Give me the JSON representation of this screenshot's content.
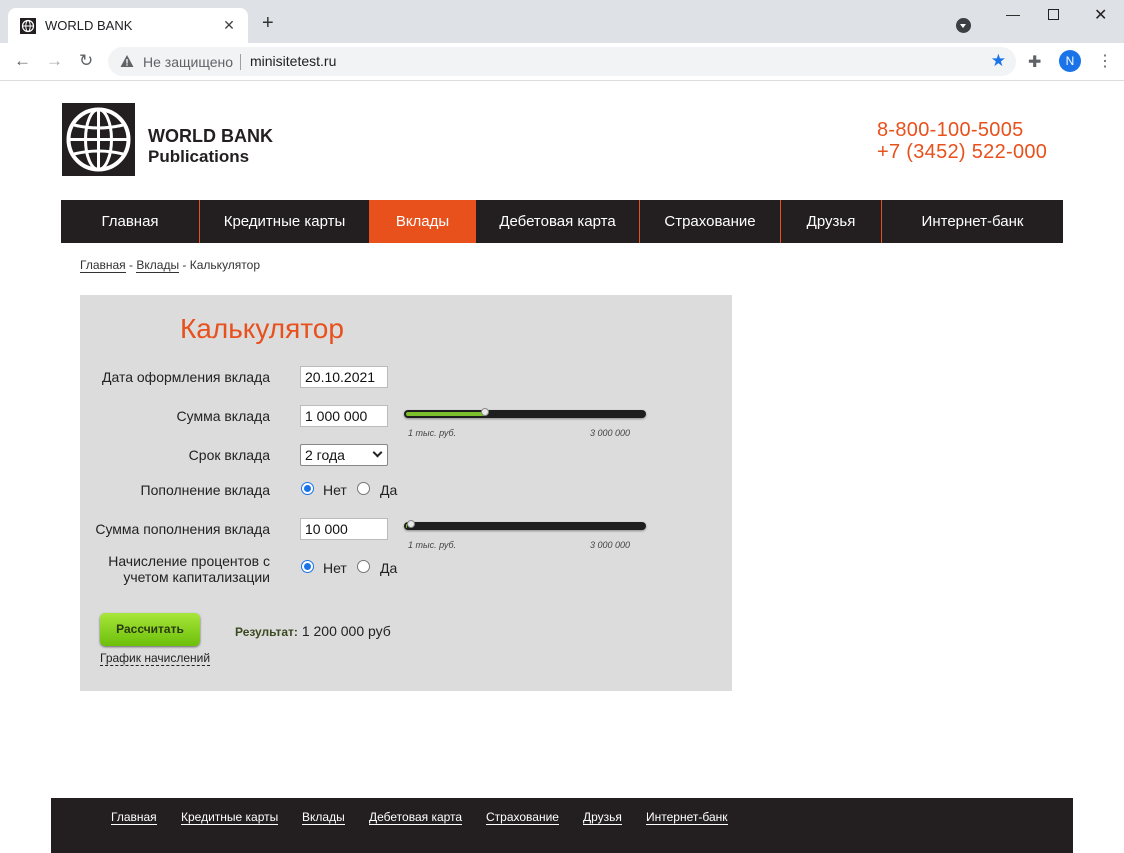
{
  "browser": {
    "tab_title": "WORLD BANK",
    "not_secure": "Не защищено",
    "url": "minisitetest.ru",
    "avatar_letter": "N"
  },
  "header": {
    "logo_line1": "WORLD BANK",
    "logo_line2": "Publications",
    "phone1": "8-800-100-5005",
    "phone2": "+7 (3452) 522-000",
    "accent_color": "#e8501c"
  },
  "menu": [
    {
      "label": "Главная",
      "active": false
    },
    {
      "label": "Кредитные карты",
      "active": false
    },
    {
      "label": "Вклады",
      "active": true
    },
    {
      "label": "Дебетовая карта",
      "active": false
    },
    {
      "label": "Страхование",
      "active": false
    },
    {
      "label": "Друзья",
      "active": false
    },
    {
      "label": "Интернет-банк",
      "active": false
    }
  ],
  "breadcrumb": {
    "home": "Главная",
    "section": "Вклады",
    "current": "Калькулятор",
    "sep": "-"
  },
  "calculator": {
    "title": "Калькулятор",
    "date_label": "Дата оформления вклада",
    "date_value": "20.10.2021",
    "amount_label": "Сумма вклада",
    "amount_value": "1 000 000",
    "amount_slider_fraction": 0.333,
    "slider_min": "1 тыс. руб.",
    "slider_max": "3 000 000",
    "term_label": "Срок вклада",
    "term_value": "2 года",
    "topup_label": "Пополнение вклада",
    "no": "Нет",
    "yes": "Да",
    "topup_amount_label": "Сумма пополнения вклада",
    "topup_amount_value": "10 000",
    "topup_slider_fraction": 0.003,
    "cap_label_line1": "Начисление процентов с",
    "cap_label_line2": "учетом капитализации",
    "button": "Рассчитать",
    "result_label": "Результат:",
    "result_value": "1 200 000 руб",
    "graph_link": "График начислений"
  },
  "footer": [
    "Главная",
    "Кредитные карты",
    "Вклады",
    "Дебетовая карта",
    "Страхование",
    "Друзья",
    "Интернет-банк"
  ]
}
